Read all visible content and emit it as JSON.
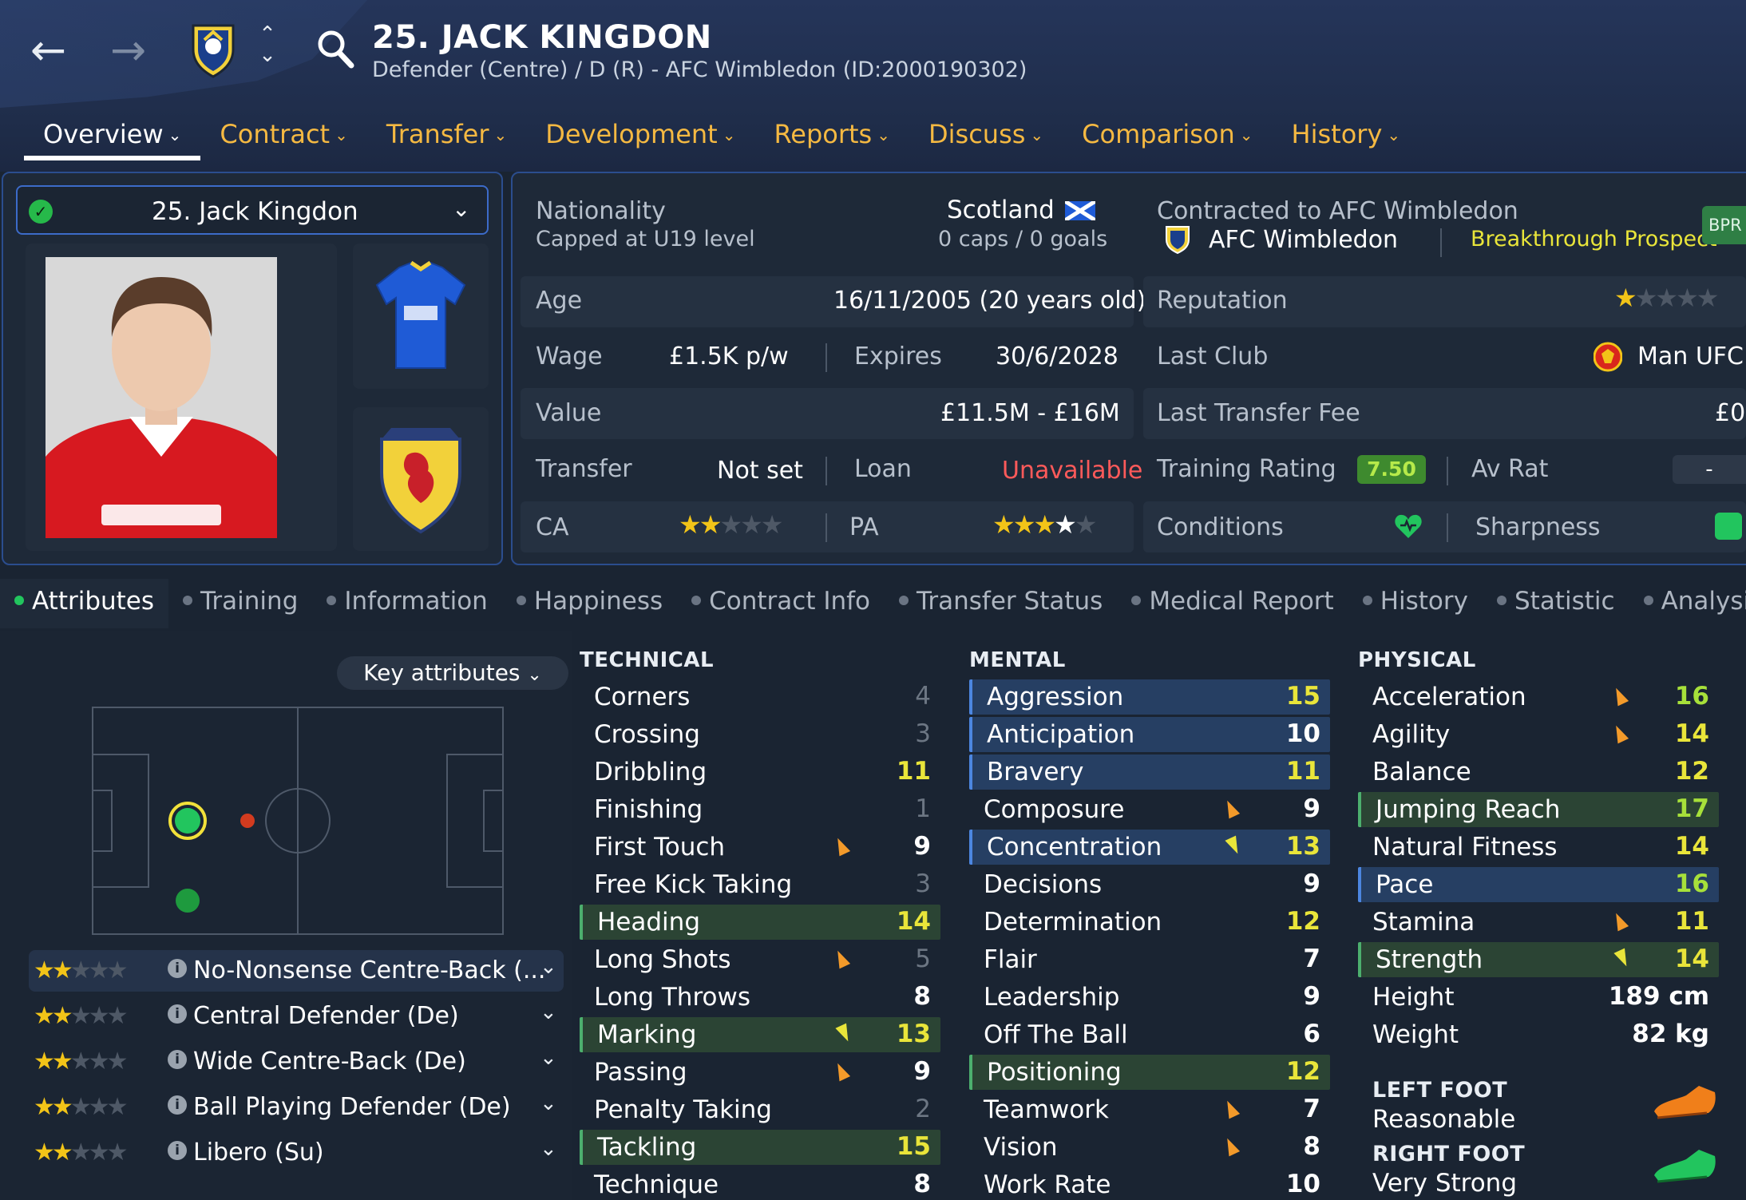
{
  "header": {
    "title": "25. JACK KINGDON",
    "subtitle": "Defender (Centre) / D (R) - AFC Wimbledon (ID:2000190302)",
    "tabs": [
      {
        "label": "Overview",
        "active": true
      },
      {
        "label": "Contract"
      },
      {
        "label": "Transfer"
      },
      {
        "label": "Development"
      },
      {
        "label": "Reports"
      },
      {
        "label": "Discuss"
      },
      {
        "label": "Comparison"
      },
      {
        "label": "History"
      }
    ],
    "icons": [
      "back-arrow-icon",
      "forward-arrow-icon",
      "club-crest-icon",
      "up-down-icon",
      "search-icon"
    ]
  },
  "player_select": {
    "label": "25. Jack Kingdon"
  },
  "info": {
    "nationality_label": "Nationality",
    "nationality_value": "Scotland",
    "capped_label": "Capped at U19 level",
    "caps_goals": "0 caps / 0 goals",
    "contract_label": "Contracted to AFC Wimbledon",
    "club": "AFC Wimbledon",
    "prospect": "Breakthrough Prospect",
    "badge": "BPR",
    "age_label": "Age",
    "age_value": "16/11/2005 (20 years old)",
    "reputation_label": "Reputation",
    "wage_label": "Wage",
    "wage_value": "£1.5K p/w",
    "expires_label": "Expires",
    "expires_value": "30/6/2028",
    "last_club_label": "Last Club",
    "last_club_value": "Man UFC",
    "value_label": "Value",
    "value_value": "£11.5M - £16M",
    "transfer_fee_label": "Last Transfer Fee",
    "transfer_fee_value": "£0",
    "transfer_label": "Transfer",
    "transfer_value": "Not set",
    "loan_label": "Loan",
    "loan_value": "Unavailable",
    "training_rating_label": "Training Rating",
    "training_rating_value": "7.50",
    "av_rat_label": "Av Rat",
    "av_rat_value": "-",
    "ca_label": "CA",
    "pa_label": "PA",
    "conditions_label": "Conditions",
    "sharpness_label": "Sharpness",
    "ratings": {
      "reputation_stars": 1,
      "ca_stars": 2,
      "pa_stars": 3.5
    }
  },
  "colors": {
    "accent": "#f5b942",
    "positive": "#22c55e",
    "unavailable": "#ff5a5a",
    "highlight_blue": "#263f63",
    "highlight_green": "#2b4434"
  },
  "sub_tabs": [
    "Attributes",
    "Training",
    "Information",
    "Happiness",
    "Contract Info",
    "Transfer Status",
    "Medical Report",
    "History",
    "Statistic",
    "Analysi"
  ],
  "key_attributes_label": "Key attributes",
  "roles": [
    {
      "stars": 2,
      "name": "No-Nonsense Centre-Back (..."
    },
    {
      "stars": 2,
      "name": "Central Defender (De)"
    },
    {
      "stars": 2,
      "name": "Wide Centre-Back (De)"
    },
    {
      "stars": 2,
      "name": "Ball Playing Defender (De)"
    },
    {
      "stars": 1.5,
      "name": "Libero (Su)"
    }
  ],
  "technical": {
    "title": "TECHNICAL",
    "rows": [
      {
        "name": "Corners",
        "value": "4"
      },
      {
        "name": "Crossing",
        "value": "3"
      },
      {
        "name": "Dribbling",
        "value": "11"
      },
      {
        "name": "Finishing",
        "value": "1"
      },
      {
        "name": "First Touch",
        "value": "9",
        "trend": "up"
      },
      {
        "name": "Free Kick Taking",
        "value": "3"
      },
      {
        "name": "Heading",
        "value": "14",
        "hl": "green"
      },
      {
        "name": "Long Shots",
        "value": "5",
        "trend": "up"
      },
      {
        "name": "Long Throws",
        "value": "8"
      },
      {
        "name": "Marking",
        "value": "13",
        "trend": "down",
        "hl": "green"
      },
      {
        "name": "Passing",
        "value": "9",
        "trend": "up"
      },
      {
        "name": "Penalty Taking",
        "value": "2"
      },
      {
        "name": "Tackling",
        "value": "15",
        "hl": "green"
      },
      {
        "name": "Technique",
        "value": "8"
      }
    ]
  },
  "mental": {
    "title": "MENTAL",
    "rows": [
      {
        "name": "Aggression",
        "value": "15",
        "hl": "blue"
      },
      {
        "name": "Anticipation",
        "value": "10",
        "hl": "blue"
      },
      {
        "name": "Bravery",
        "value": "11",
        "hl": "blue"
      },
      {
        "name": "Composure",
        "value": "9",
        "trend": "up"
      },
      {
        "name": "Concentration",
        "value": "13",
        "trend": "down",
        "hl": "blue"
      },
      {
        "name": "Decisions",
        "value": "9"
      },
      {
        "name": "Determination",
        "value": "12"
      },
      {
        "name": "Flair",
        "value": "7"
      },
      {
        "name": "Leadership",
        "value": "9"
      },
      {
        "name": "Off The Ball",
        "value": "6"
      },
      {
        "name": "Positioning",
        "value": "12",
        "hl": "green"
      },
      {
        "name": "Teamwork",
        "value": "7",
        "trend": "up"
      },
      {
        "name": "Vision",
        "value": "8",
        "trend": "up"
      },
      {
        "name": "Work Rate",
        "value": "10"
      }
    ]
  },
  "physical": {
    "title": "PHYSICAL",
    "rows": [
      {
        "name": "Acceleration",
        "value": "16",
        "trend": "up"
      },
      {
        "name": "Agility",
        "value": "14",
        "trend": "up"
      },
      {
        "name": "Balance",
        "value": "12"
      },
      {
        "name": "Jumping Reach",
        "value": "17",
        "hl": "green"
      },
      {
        "name": "Natural Fitness",
        "value": "14"
      },
      {
        "name": "Pace",
        "value": "16",
        "hl": "blue"
      },
      {
        "name": "Stamina",
        "value": "11",
        "trend": "up"
      },
      {
        "name": "Strength",
        "value": "14",
        "trend": "down",
        "hl": "green"
      },
      {
        "name": "Height",
        "value": "189 cm"
      },
      {
        "name": "Weight",
        "value": "82 kg"
      }
    ],
    "left_foot_label": "LEFT FOOT",
    "left_foot_value": "Reasonable",
    "right_foot_label": "RIGHT FOOT",
    "right_foot_value": "Very Strong"
  }
}
